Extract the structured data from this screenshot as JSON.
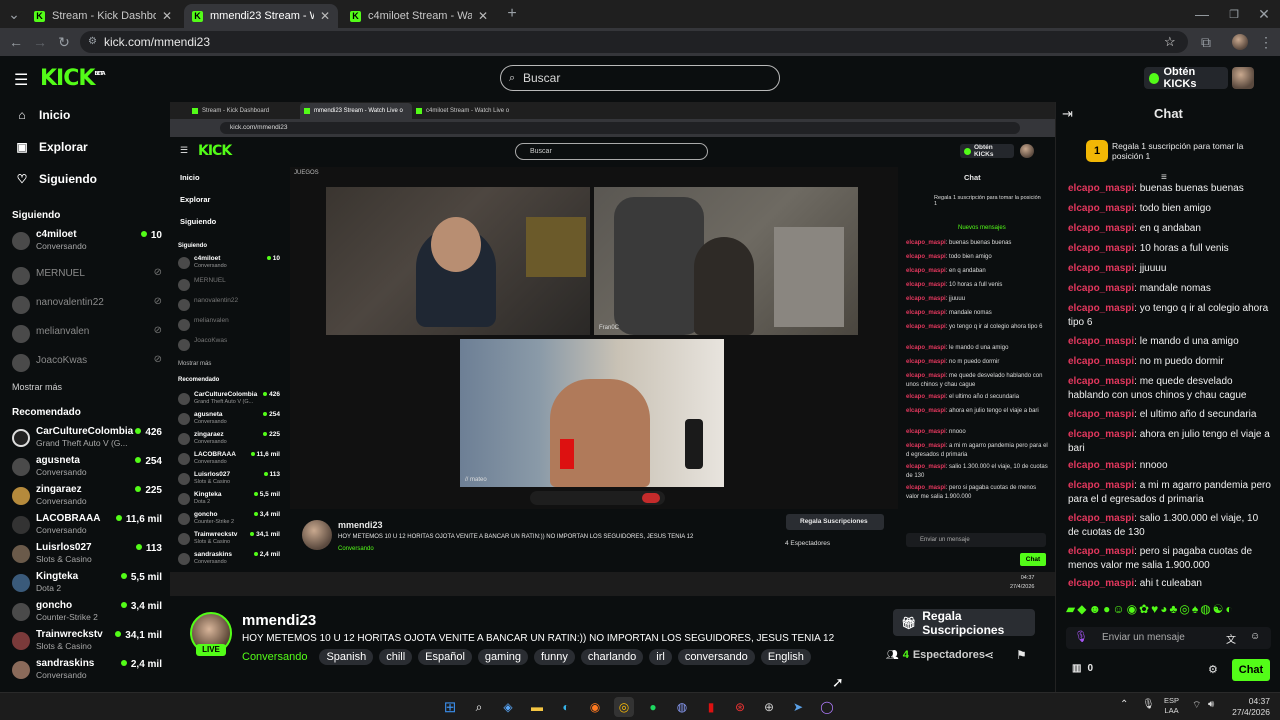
{
  "browser": {
    "tabs": [
      {
        "title": "Stream - Kick Dashboard"
      },
      {
        "title": "mmendi23 Stream - Watch Live o"
      },
      {
        "title": "c4miloet Stream - Watch Live o"
      }
    ],
    "url": "kick.com/mmendi23"
  },
  "header": {
    "logo": "KICK",
    "beta": "BETA",
    "search_placeholder": "Buscar",
    "kicks_label": "Obtén KICKs"
  },
  "nav": [
    {
      "label": "Inicio",
      "icon": "home-icon"
    },
    {
      "label": "Explorar",
      "icon": "compass-icon"
    },
    {
      "label": "Siguiendo",
      "icon": "heart-icon"
    }
  ],
  "following": {
    "title": "Siguiendo",
    "channels": [
      {
        "name": "c4miloet",
        "category": "Conversando",
        "viewers": "10",
        "live": true
      },
      {
        "name": "MERNUEL",
        "category": "",
        "viewers": "",
        "live": false
      },
      {
        "name": "nanovalentin22",
        "category": "",
        "viewers": "",
        "live": false
      },
      {
        "name": "melianvalen",
        "category": "",
        "viewers": "",
        "live": false
      },
      {
        "name": "JoacoKwas",
        "category": "",
        "viewers": "",
        "live": false
      }
    ],
    "show_more": "Mostrar más"
  },
  "recommended": {
    "title": "Recomendado",
    "channels": [
      {
        "name": "CarCultureColombia",
        "category": "Grand Theft Auto V (G...",
        "viewers": "426"
      },
      {
        "name": "agusneta",
        "category": "Conversando",
        "viewers": "254"
      },
      {
        "name": "zingaraez",
        "category": "Conversando",
        "viewers": "225"
      },
      {
        "name": "LACOBRAAA",
        "category": "Conversando",
        "viewers": "11,6 mil"
      },
      {
        "name": "Luisrlos027",
        "category": "Slots & Casino",
        "viewers": "113"
      },
      {
        "name": "Kingteka",
        "category": "Dota 2",
        "viewers": "5,5 mil"
      },
      {
        "name": "goncho",
        "category": "Counter-Strike 2",
        "viewers": "3,4 mil"
      },
      {
        "name": "Trainwreckstv",
        "category": "Slots & Casino",
        "viewers": "34,1 mil"
      },
      {
        "name": "sandraskins",
        "category": "Conversando",
        "viewers": "2,4 mil"
      }
    ]
  },
  "embedded": {
    "tabs": [
      {
        "title": "Stream - Kick Dashboard"
      },
      {
        "title": "mmendi23 Stream - Watch Live o"
      },
      {
        "title": "c4miloet Stream - Watch Live o"
      }
    ],
    "url": "kick.com/mmendi23",
    "search_placeholder": "Buscar",
    "kicks_label": "Obtén KICKs",
    "following_show_more": "Mostrar más",
    "stream_time": "JUEGOS",
    "cam_labels": [
      "",
      "Fran0C",
      "// mateo"
    ],
    "chat_title": "Chat",
    "pin_text": "Regala 1 suscripción para tomar la posición 1",
    "new_messages": "Nuevos mensajes",
    "messages": [
      {
        "user": "elcapo_maspi",
        "text": "buenas buenas buenas"
      },
      {
        "user": "elcapo_maspi",
        "text": "todo bien amigo"
      },
      {
        "user": "elcapo_maspi",
        "text": "en q andaban"
      },
      {
        "user": "elcapo_maspi",
        "text": "10 horas a full venis"
      },
      {
        "user": "elcapo_maspi",
        "text": "jjuuuu"
      },
      {
        "user": "elcapo_maspi",
        "text": "mandale nomas"
      },
      {
        "user": "elcapo_maspi",
        "text": "yo tengo q ir al colegio ahora tipo 6"
      },
      {
        "user": "elcapo_maspi",
        "text": "le mando d una amigo"
      },
      {
        "user": "elcapo_maspi",
        "text": "no m puedo dormir"
      },
      {
        "user": "elcapo_maspi",
        "text": "me quede desvelado hablando con unos chinos y chau cague"
      },
      {
        "user": "elcapo_maspi",
        "text": "el ultimo año d secundaria"
      },
      {
        "user": "elcapo_maspi",
        "text": "ahora en julio tengo el viaje a bari"
      },
      {
        "user": "elcapo_maspi",
        "text": "nnooo"
      },
      {
        "user": "elcapo_maspi",
        "text": "a mi m agarro pandemia pero para el d egresados d primaria"
      },
      {
        "user": "elcapo_maspi",
        "text": "salio 1.300.000 el viaje, 10 de cuotas de 130"
      },
      {
        "user": "elcapo_maspi",
        "text": "pero si pagaba cuotas de menos valor me salia 1.900.000"
      }
    ],
    "chat_placeholder": "Enviar un mensaje",
    "chat_points": "0",
    "chat_button": "Chat",
    "viewers": "4 Espectadores",
    "clock_time": "04:37",
    "clock_date": "27/4/2026",
    "lang": "ESP\nLAA"
  },
  "stream": {
    "streamer": "mmendi23",
    "live_badge": "LIVE",
    "title": "HOY METEMOS 10 U 12 HORITAS OJOTA VENITE A BANCAR UN RATIN:)) NO IMPORTAN LOS SEGUIDORES, JESUS TENIA 12",
    "category": "Conversando",
    "tags": [
      "Spanish",
      "chill",
      "Español",
      "gaming",
      "funny",
      "charlando",
      "irl",
      "conversando",
      "English"
    ],
    "sub_button": "Regala Suscripciones",
    "viewers_count": "4",
    "viewers_label": "Espectadores"
  },
  "chat": {
    "title": "Chat",
    "pin_text": "Regala 1 suscripción para tomar la posición 1",
    "messages": [
      {
        "user": "elcapo_maspi",
        "text": "buenas buenas buenas"
      },
      {
        "user": "elcapo_maspi",
        "text": "todo bien amigo"
      },
      {
        "user": "elcapo_maspi",
        "text": "en q andaban"
      },
      {
        "user": "elcapo_maspi",
        "text": "10 horas a full venis"
      },
      {
        "user": "elcapo_maspi",
        "text": "jjuuuu"
      },
      {
        "user": "elcapo_maspi",
        "text": "mandale nomas"
      },
      {
        "user": "elcapo_maspi",
        "text": "yo tengo q ir al colegio ahora tipo 6"
      },
      {
        "user": "elcapo_maspi",
        "text": "le mando d una amigo"
      },
      {
        "user": "elcapo_maspi",
        "text": "no m puedo dormir"
      },
      {
        "user": "elcapo_maspi",
        "text": "me quede desvelado hablando con unos chinos y chau cague"
      },
      {
        "user": "elcapo_maspi",
        "text": "el ultimo año d secundaria"
      },
      {
        "user": "elcapo_maspi",
        "text": "ahora en julio tengo el viaje a bari"
      },
      {
        "user": "elcapo_maspi",
        "text": "nnooo"
      },
      {
        "user": "elcapo_maspi",
        "text": "a mi m agarro pandemia pero para el d egresados d primaria"
      },
      {
        "user": "elcapo_maspi",
        "text": "salio 1.300.000 el viaje, 10 de cuotas de 130"
      },
      {
        "user": "elcapo_maspi",
        "text": "pero si pagaba cuotas de menos valor me salia 1.900.000"
      },
      {
        "user": "elcapo_maspi",
        "text": "ahi t culeaban"
      }
    ],
    "input_placeholder": "Enviar un mensaje",
    "points": "0",
    "send_label": "Chat"
  },
  "taskbar": {
    "lang_top": "ESP",
    "lang_bottom": "LAA",
    "time": "04:37",
    "date": "27/4/2026"
  },
  "colors": {
    "brand": "#53fc18",
    "username": "#e2375d",
    "background": "#0b0e0f"
  }
}
